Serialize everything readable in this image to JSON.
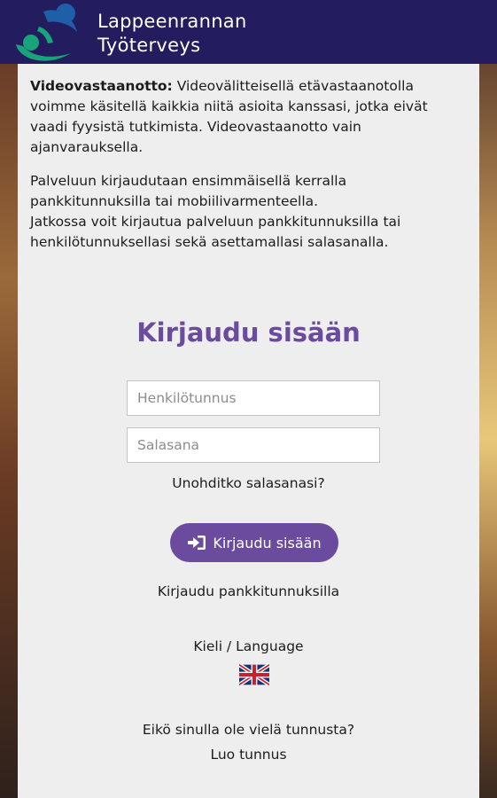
{
  "header": {
    "brand_line1": "Lappeenrannan",
    "brand_line2": "Työterveys"
  },
  "intro": {
    "video_title": "Videovastaanotto:",
    "video_text": " Videovälitteisellä etävastaanotolla voimme käsitellä kaikkia niitä asioita kanssasi, jotka eivät vaadi fyysistä tutkimista. Videovastaanotto vain ajanvarauksella.",
    "login_info_line1": "Palveluun kirjaudutaan ensimmäisellä kerralla pankkitunnuksilla tai mobiilivarmenteella.",
    "login_info_line2": "Jatkossa voit kirjautua palveluun pankkitunnuksilla tai henkilötunnuksellasi sekä asettamallasi salasanalla."
  },
  "login": {
    "title": "Kirjaudu sisään",
    "user_placeholder": "Henkilötunnus",
    "user_value": "",
    "password_placeholder": "Salasana",
    "password_value": "",
    "forgot_link": "Unohditko salasanasi?",
    "submit_label": "Kirjaudu sisään",
    "bank_login_link": "Kirjaudu pankkitunnuksilla"
  },
  "language": {
    "label": "Kieli / Language",
    "flag_icon": "uk-flag-icon"
  },
  "register": {
    "question": "Eikö sinulla ole vielä tunnusta?",
    "create_link": "Luo tunnus"
  },
  "colors": {
    "header_bg": "#231c5e",
    "accent": "#6b4b9e",
    "logo_green": "#1aa37a",
    "logo_blue": "#1f5fa8"
  }
}
